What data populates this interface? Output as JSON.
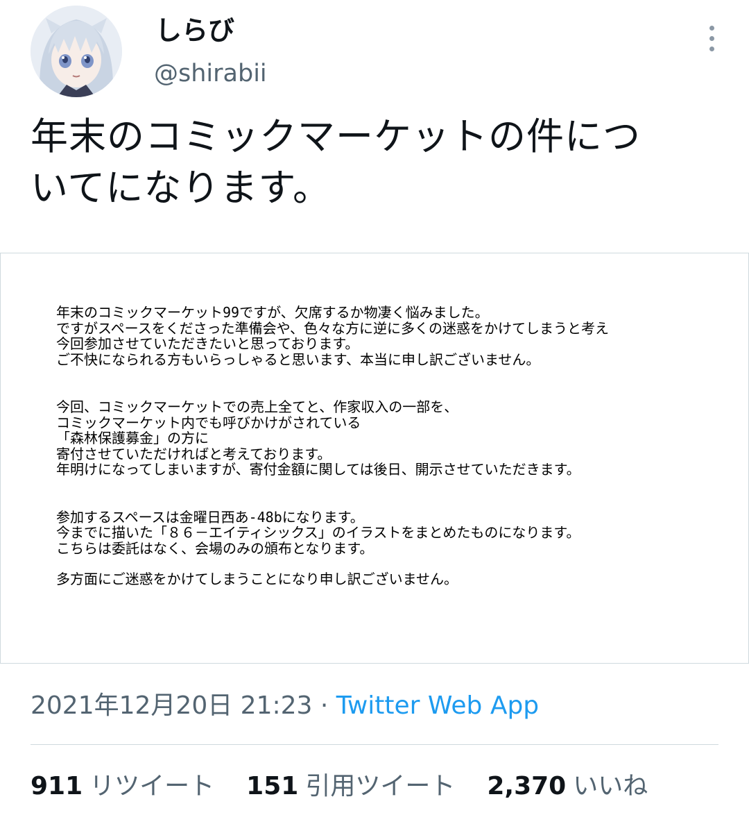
{
  "author": {
    "display_name": "しらび",
    "handle": "@shirabii"
  },
  "tweet": {
    "text_lines": [
      "年末のコミックマーケットの件につ",
      "いてになります。"
    ]
  },
  "notice": {
    "paragraphs": [
      {
        "lines": [
          "年末のコミックマーケット99ですが、欠席するか物凄く悩みました。",
          "ですがスペースをくださった準備会や、色々な方に逆に多くの迷惑をかけてしまうと考え",
          "今回参加させていただきたいと思っております。",
          "ご不快になられる方もいらっしゃると思います、本当に申し訳ございません。"
        ]
      },
      {
        "lines": [
          "今回、コミックマーケットでの売上全てと、作家収入の一部を、",
          "コミックマーケット内でも呼びかけがされている",
          "「森林保護募金」の方に",
          "寄付させていただければと考えております。",
          "年明けになってしまいますが、寄付金額に関しては後日、開示させていただきます。"
        ]
      },
      {
        "lines": [
          "参加するスペースは金曜日西あ-48bになります。",
          "今までに描いた「８６－エイティシックス」のイラストをまとめたものになります。",
          "こちらは委託はなく、会場のみの頒布となります。"
        ]
      },
      {
        "lines": [
          "多方面にご迷惑をかけてしまうことになり申し訳ございません。"
        ]
      }
    ]
  },
  "meta": {
    "timestamp": "2021年12月20日 21:23",
    "separator": "·",
    "source": "Twitter Web App"
  },
  "stats": {
    "retweets": {
      "count": "911",
      "label": "リツイート"
    },
    "quotes": {
      "count": "151",
      "label": "引用ツイート"
    },
    "likes": {
      "count": "2,370",
      "label": "いいね"
    }
  },
  "colors": {
    "text_primary": "#0f1419",
    "text_secondary": "#536471",
    "link": "#1d9bf0",
    "border": "#cfd9de"
  },
  "icons": {
    "more": "more-vertical-icon",
    "avatar": "avatar-illustration"
  }
}
